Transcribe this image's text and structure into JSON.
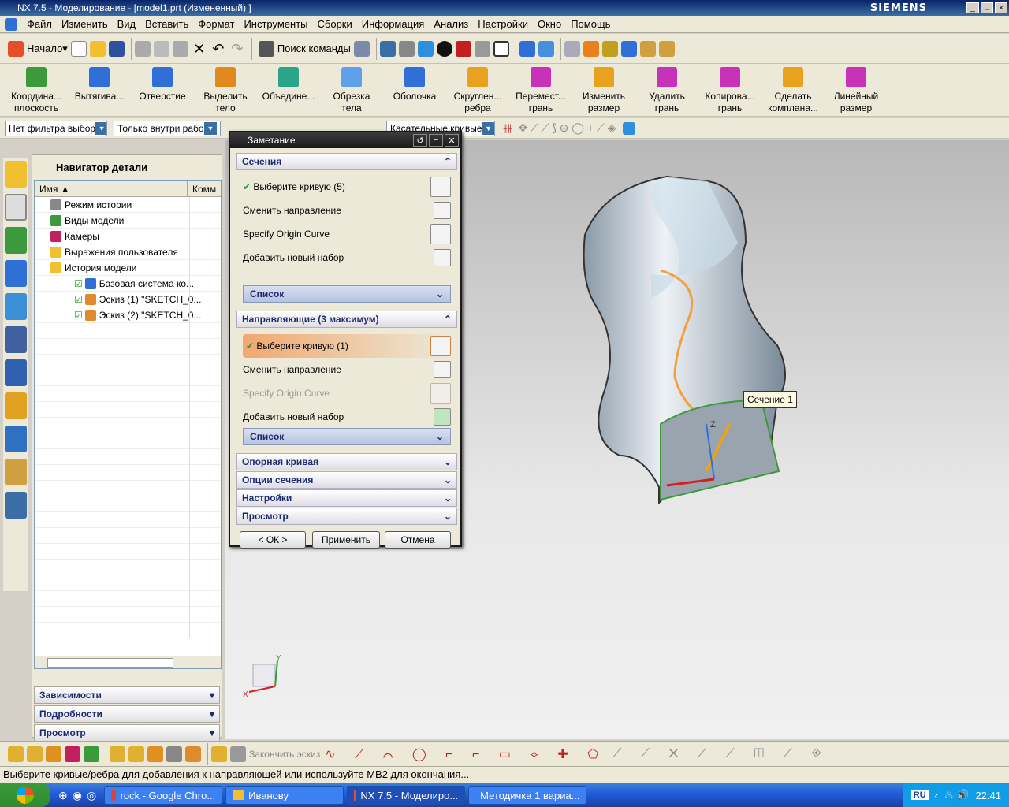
{
  "window": {
    "title": "NX 7.5 - Моделирование - [model1.prt (Измененный) ]",
    "brand": "SIEMENS"
  },
  "menu": [
    "Файл",
    "Изменить",
    "Вид",
    "Вставить",
    "Формат",
    "Инструменты",
    "Сборки",
    "Информация",
    "Анализ",
    "Настройки",
    "Окно",
    "Помощь"
  ],
  "toolbar1": {
    "start": "Начало",
    "search": "Поиск команды"
  },
  "toolbar2": [
    {
      "l1": "Координа...",
      "l2": "плоскость",
      "color": "#3c9a3c"
    },
    {
      "l1": "Вытягива...",
      "l2": "",
      "color": "#2f6fd6"
    },
    {
      "l1": "Отверстие",
      "l2": "",
      "color": "#2f6fd6"
    },
    {
      "l1": "Выделить",
      "l2": "тело",
      "color": "#e08a1e"
    },
    {
      "l1": "Объедине...",
      "l2": "",
      "color": "#2aa58a"
    },
    {
      "l1": "Обрезка",
      "l2": "тела",
      "color": "#5fa0e8"
    },
    {
      "l1": "Оболочка",
      "l2": "",
      "color": "#2f6fd6"
    },
    {
      "l1": "Скруглен...",
      "l2": "ребра",
      "color": "#e8a21e"
    },
    {
      "l1": "Перемест...",
      "l2": "грань",
      "color": "#c832b8"
    },
    {
      "l1": "Изменить",
      "l2": "размер",
      "color": "#e8a21e"
    },
    {
      "l1": "Удалить",
      "l2": "грань",
      "color": "#c832b8"
    },
    {
      "l1": "Копирова...",
      "l2": "грань",
      "color": "#c832b8"
    },
    {
      "l1": "Сделать",
      "l2": "компланa...",
      "color": "#e8a21e"
    },
    {
      "l1": "Линейный",
      "l2": "размер",
      "color": "#c832b8"
    }
  ],
  "toolbar3": {
    "filter": "Нет фильтра выбор",
    "scope": "Только внутри рабо",
    "curve": "Касательные кривые"
  },
  "navigator": {
    "title": "Навигатор детали",
    "col_name": "Имя",
    "col_comment": "Комм",
    "rows": [
      {
        "label": "Режим истории",
        "indent": 20
      },
      {
        "label": "Виды модели",
        "indent": 20
      },
      {
        "label": "Камеры",
        "indent": 20
      },
      {
        "label": "Выражения пользователя",
        "indent": 20
      },
      {
        "label": "История модели",
        "indent": 20
      },
      {
        "label": "Базовая система ко...",
        "indent": 40
      },
      {
        "label": "Эскиз (1) \"SKETCH_0...",
        "indent": 40
      },
      {
        "label": "Эскиз (2) \"SKETCH_0...",
        "indent": 40
      }
    ],
    "sections": [
      "Зависимости",
      "Подробности",
      "Просмотр"
    ]
  },
  "dialog": {
    "title": "Заметание",
    "sections_group": "Сечения",
    "select_curve_1": "Выберите кривую (5)",
    "change_dir_1": "Сменить направление",
    "origin_1": "Specify Origin Curve",
    "add_set_1": "Добавить новый набор",
    "list_1": "Список",
    "guides_group": "Направляющие (3 максимум)",
    "select_curve_2": "Выберите кривую (1)",
    "change_dir_2": "Сменить направление",
    "origin_2": "Specify Origin Curve",
    "add_set_2": "Добавить новый набор",
    "list_2": "Список",
    "collapsed": [
      "Опорная кривая",
      "Опции сечения",
      "Настройки",
      "Просмотр"
    ],
    "ok": "< ОК >",
    "apply": "Применить",
    "cancel": "Отмена"
  },
  "viewport": {
    "tooltip": "Сечение 1"
  },
  "bottom_toolbar": {
    "finish_sketch": "Закончить эскиз"
  },
  "status": "Выберите кривые/ребра для добавления к направляющей или используйте MB2 для окончания...",
  "taskbar": {
    "tasks": [
      "rock - Google Chro...",
      "Иванову",
      "NX 7.5 - Моделиро...",
      "Методичка 1 вариа..."
    ],
    "lang": "RU",
    "time": "22:41"
  }
}
